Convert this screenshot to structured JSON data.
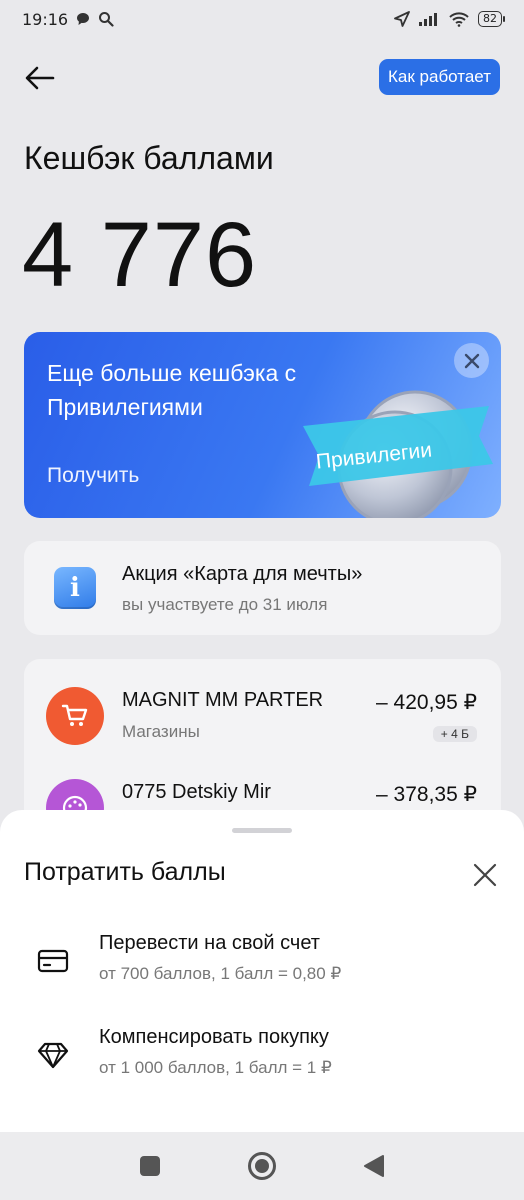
{
  "status_bar": {
    "time": "19:16",
    "battery": "82"
  },
  "header": {
    "how_it_works": "Как работает"
  },
  "page": {
    "title": "Кешбэк баллами",
    "balance": "4 776"
  },
  "promo": {
    "text": "Еще больше кешбэка с Привилегиями",
    "get_label": "Получить",
    "ribbon": "Привилегии"
  },
  "action": {
    "title": "Акция «Карта для мечты»",
    "subtitle": "вы участвуете до 31 июля"
  },
  "transactions": [
    {
      "name": "MAGNIT MM PARTER",
      "category": "Магазины",
      "amount": "– 420,95 ₽",
      "bonus": "+ 4 Б",
      "icon": "cart-icon",
      "color": "#f05a32"
    },
    {
      "name": "0775 Detskiy Mir",
      "category": "",
      "amount": "– 378,35 ₽",
      "bonus": "",
      "icon": "palette-icon",
      "color": "#b556d6"
    }
  ],
  "sheet": {
    "title": "Потратить баллы",
    "options": [
      {
        "title": "Перевести на свой счет",
        "subtitle": "от 700 баллов, 1 балл = 0,80 ₽",
        "icon": "card-icon"
      },
      {
        "title": "Компенсировать покупку",
        "subtitle": "от 1 000 баллов, 1 балл = 1 ₽",
        "icon": "diamond-icon"
      }
    ]
  },
  "colors": {
    "accent": "#2b6fe6",
    "promo_start": "#2a5ee8",
    "promo_end": "#7fb0ff"
  }
}
